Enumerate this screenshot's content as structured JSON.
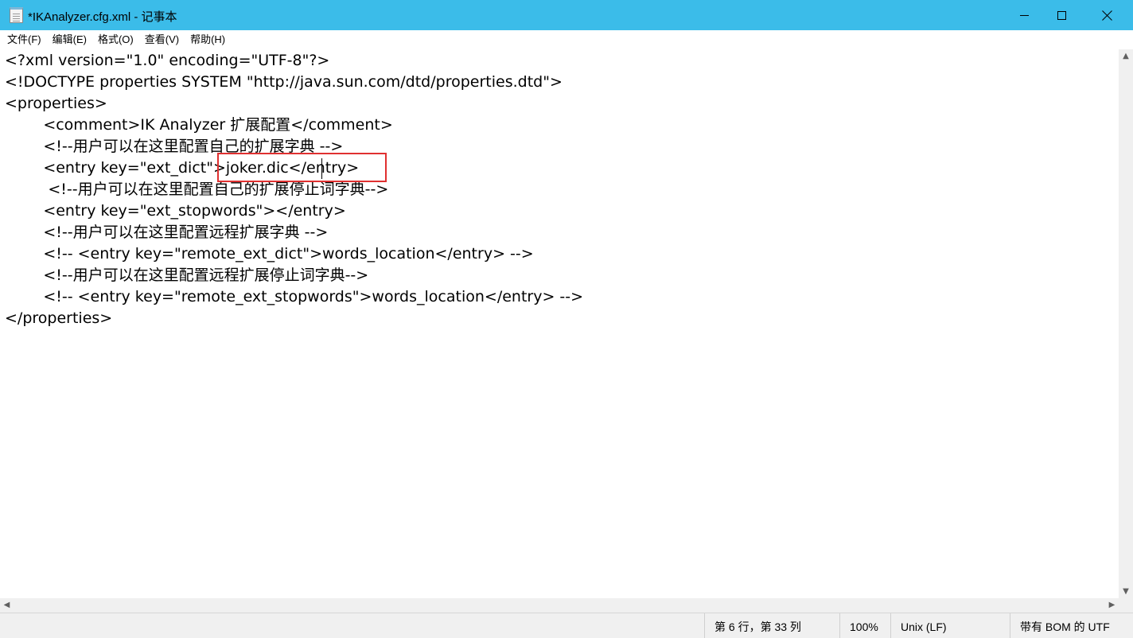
{
  "window": {
    "title": "*IKAnalyzer.cfg.xml - 记事本"
  },
  "menu": {
    "items": [
      "文件(F)",
      "编辑(E)",
      "格式(O)",
      "查看(V)",
      "帮助(H)"
    ]
  },
  "editor": {
    "lines": [
      "<?xml version=\"1.0\" encoding=\"UTF-8\"?>",
      "<!DOCTYPE properties SYSTEM \"http://java.sun.com/dtd/properties.dtd\">",
      "<properties>",
      "\t<comment>IK Analyzer 扩展配置</comment>",
      "\t<!--用户可以在这里配置自己的扩展字典 -->",
      "\t<entry key=\"ext_dict\">joker.dic</entry>",
      "\t <!--用户可以在这里配置自己的扩展停止词字典-->",
      "\t<entry key=\"ext_stopwords\"></entry>",
      "\t<!--用户可以在这里配置远程扩展字典 -->",
      "\t<!-- <entry key=\"remote_ext_dict\">words_location</entry> -->",
      "\t<!--用户可以在这里配置远程扩展停止词字典-->",
      "\t<!-- <entry key=\"remote_ext_stopwords\">words_location</entry> -->",
      "</properties>"
    ]
  },
  "status": {
    "position": "第 6 行，第 33 列",
    "zoom": "100%",
    "line_ending": "Unix (LF)",
    "encoding": "带有 BOM 的 UTF"
  },
  "colors": {
    "titlebar": "#3bbce9",
    "highlight": "#e03030"
  },
  "icons": {
    "app": "notepad-icon",
    "minimize": "minimize-icon",
    "maximize": "maximize-icon",
    "close": "close-icon"
  }
}
